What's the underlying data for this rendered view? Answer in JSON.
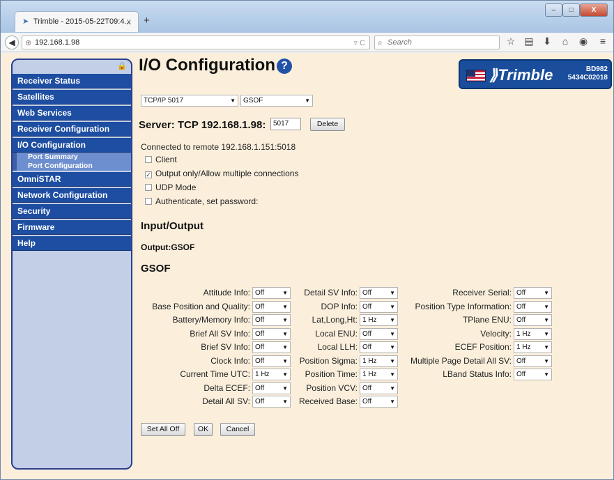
{
  "browser": {
    "tab_title": "Trimble - 2015-05-22T09:4...",
    "tab_close": "x",
    "new_tab": "+",
    "url": "192.168.1.98",
    "search_placeholder": "Search",
    "win_min": "–",
    "win_max": "□",
    "win_close": "X"
  },
  "sidebar": {
    "items": [
      {
        "label": "Receiver Status"
      },
      {
        "label": "Satellites"
      },
      {
        "label": "Web Services"
      },
      {
        "label": "Receiver Configuration"
      },
      {
        "label": "I/O Configuration"
      },
      {
        "label": "OmniSTAR"
      },
      {
        "label": "Network Configuration"
      },
      {
        "label": "Security"
      },
      {
        "label": "Firmware"
      },
      {
        "label": "Help"
      }
    ],
    "subitems": [
      {
        "label": "Port Summary"
      },
      {
        "label": "Port Configuration"
      }
    ]
  },
  "header": {
    "title": "I/O Configuration",
    "help": "?",
    "brand": "Trimble",
    "model": "BD982",
    "serial": "5434C02018"
  },
  "port_select": {
    "value": "TCP/IP 5017"
  },
  "format_select": {
    "value": "GSOF"
  },
  "server": {
    "label": "Server: TCP 192.168.1.98:",
    "port": "5017",
    "delete_label": "Delete"
  },
  "connected": "Connected to remote 192.168.1.151:5018",
  "options": [
    {
      "label": "Client",
      "checked": false
    },
    {
      "label": "Output only/Allow multiple connections",
      "checked": true
    },
    {
      "label": "UDP Mode",
      "checked": false
    },
    {
      "label": "Authenticate, set password:",
      "checked": false
    }
  ],
  "io_heading": "Input/Output",
  "output_label": "Output:GSOF",
  "gsof_heading": "GSOF",
  "gsof_fields": {
    "col1": [
      {
        "label": "Attitude Info:",
        "value": "Off"
      },
      {
        "label": "Base Position and Quality:",
        "value": "Off"
      },
      {
        "label": "Battery/Memory Info:",
        "value": "Off"
      },
      {
        "label": "Brief All SV Info:",
        "value": "Off"
      },
      {
        "label": "Brief SV Info:",
        "value": "Off"
      },
      {
        "label": "Clock Info:",
        "value": "Off"
      },
      {
        "label": "Current Time UTC:",
        "value": "1 Hz"
      },
      {
        "label": "Delta ECEF:",
        "value": "Off"
      },
      {
        "label": "Detail All SV:",
        "value": "Off"
      }
    ],
    "col2": [
      {
        "label": "Detail SV Info:",
        "value": "Off"
      },
      {
        "label": "DOP Info:",
        "value": "Off"
      },
      {
        "label": "Lat,Long,Ht:",
        "value": "1 Hz"
      },
      {
        "label": "Local ENU:",
        "value": "Off"
      },
      {
        "label": "Local LLH:",
        "value": "Off"
      },
      {
        "label": "Position Sigma:",
        "value": "1 Hz"
      },
      {
        "label": "Position Time:",
        "value": "1 Hz"
      },
      {
        "label": "Position VCV:",
        "value": "Off"
      },
      {
        "label": "Received Base:",
        "value": "Off"
      }
    ],
    "col3": [
      {
        "label": "Receiver Serial:",
        "value": "Off"
      },
      {
        "label": "Position Type Information:",
        "value": "Off"
      },
      {
        "label": "TPlane ENU:",
        "value": "Off"
      },
      {
        "label": "Velocity:",
        "value": "1 Hz"
      },
      {
        "label": "ECEF Position:",
        "value": "1 Hz"
      },
      {
        "label": "Multiple Page Detail All SV:",
        "value": "Off"
      },
      {
        "label": "LBand Status Info:",
        "value": "Off"
      }
    ]
  },
  "buttons": {
    "set_all_off": "Set All Off",
    "ok": "OK",
    "cancel": "Cancel"
  }
}
